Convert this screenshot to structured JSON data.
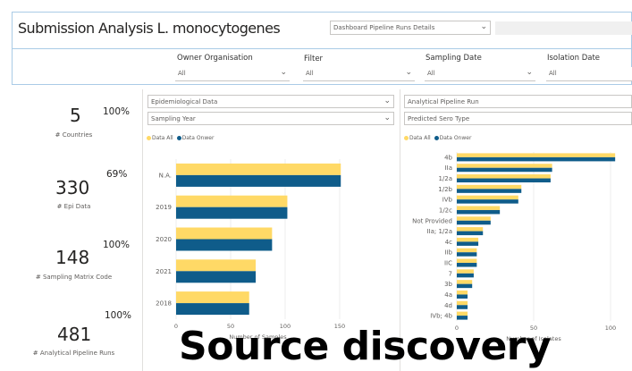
{
  "header": {
    "title": "Submission Analysis L. monocytogenes",
    "pipeline_dropdown": "Dashboard Pipeline Runs Details"
  },
  "filters": [
    {
      "label": "Owner Organisation",
      "value": "All"
    },
    {
      "label": "Filter",
      "value": "All"
    },
    {
      "label": "Sampling Date",
      "value": "All"
    },
    {
      "label": "Isolation Date",
      "value": "All"
    }
  ],
  "kpis": [
    {
      "value": "5",
      "label": "# Countries",
      "pct": "100%"
    },
    {
      "value": "330",
      "label": "# Epi Data",
      "pct": "69%"
    },
    {
      "value": "148",
      "label": "# Sampling Matrix Code",
      "pct": "100%"
    },
    {
      "value": "481",
      "label": "# Analytical Pipeline Runs",
      "pct": "100%"
    }
  ],
  "left_panel": {
    "dropdown1": "Epidemiological Data",
    "dropdown2": "Sampling Year"
  },
  "right_panel": {
    "dropdown1": "Analytical Pipeline Run",
    "dropdown2": "Predicted Sero Type"
  },
  "legend": {
    "all": "Data All",
    "owner": "Data Onwer"
  },
  "colors": {
    "data_all": "#ffd966",
    "data_owner": "#0f5c8a"
  },
  "watermark": "Source discovery",
  "chart_data": [
    {
      "type": "bar",
      "orientation": "horizontal",
      "categories": [
        "N.A.",
        "2019",
        "2020",
        "2021",
        "2018"
      ],
      "series": [
        {
          "name": "Data All",
          "values": [
            151,
            102,
            88,
            73,
            67
          ]
        },
        {
          "name": "Data Onwer",
          "values": [
            151,
            102,
            88,
            73,
            67
          ]
        }
      ],
      "xlim": [
        0,
        150
      ],
      "xticks": [
        0,
        50,
        100,
        150
      ],
      "xlabel": "Number of Samples"
    },
    {
      "type": "bar",
      "orientation": "horizontal",
      "categories": [
        "4b",
        "IIa",
        "1/2a",
        "1/2b",
        "IVb",
        "1/2c",
        "Not Provided",
        "IIa; 1/2a",
        "4c",
        "IIb",
        "IIC",
        "7",
        "3b",
        "4a",
        "4d",
        "IVb; 4b"
      ],
      "series": [
        {
          "name": "Data All",
          "values": [
            103,
            62,
            61,
            42,
            40,
            28,
            22,
            17,
            14,
            13,
            13,
            11,
            10,
            7,
            7,
            7
          ]
        },
        {
          "name": "Data Onwer",
          "values": [
            103,
            62,
            61,
            42,
            40,
            28,
            22,
            17,
            14,
            13,
            13,
            11,
            10,
            7,
            7,
            7
          ]
        }
      ],
      "xlim": [
        0,
        100
      ],
      "xticks": [
        0,
        50,
        100
      ],
      "xlabel": "Number of Isolates"
    }
  ]
}
